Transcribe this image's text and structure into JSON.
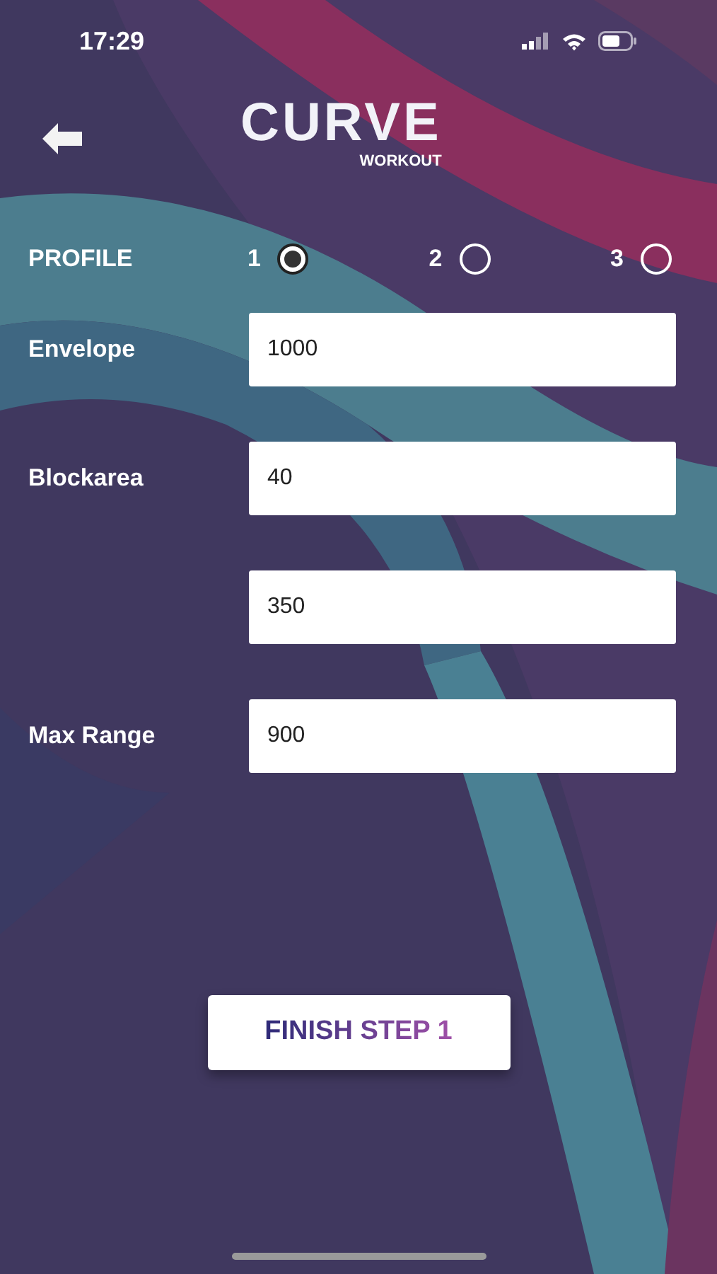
{
  "status_bar": {
    "time": "17:29"
  },
  "header": {
    "logo": "CURVE",
    "logo_subtitle": "WORKOUT"
  },
  "profile": {
    "label": "PROFILE",
    "options": [
      {
        "label": "1",
        "selected": true
      },
      {
        "label": "2",
        "selected": false
      },
      {
        "label": "3",
        "selected": false
      }
    ]
  },
  "fields": [
    {
      "label": "Envelope",
      "value": "1000"
    },
    {
      "value": "40",
      "label": "Blockarea"
    },
    {
      "value": "350"
    },
    {
      "label": "Max Range",
      "value": "900"
    }
  ],
  "button": "FINISH STEP 1"
}
